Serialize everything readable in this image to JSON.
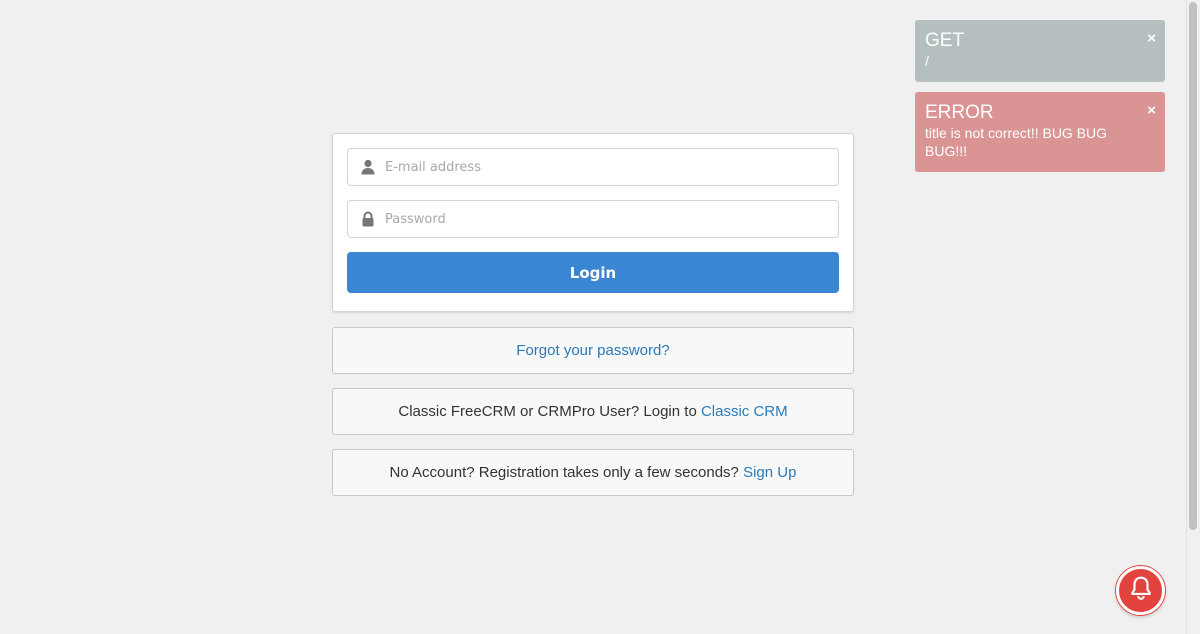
{
  "login_form": {
    "email_placeholder": "E-mail address",
    "password_placeholder": "Password",
    "login_label": "Login"
  },
  "links": {
    "forgot_password": "Forgot your password?",
    "classic_prefix": "Classic FreeCRM or CRMPro User? Login to ",
    "classic_link": "Classic CRM",
    "signup_prefix": "No Account? Registration takes only a few seconds? ",
    "signup_link": "Sign Up"
  },
  "toasts": [
    {
      "title": "GET",
      "message": "/",
      "close": "×",
      "color": "#b6bfbf"
    },
    {
      "title": "ERROR",
      "message": "title is not correct!! BUG BUG BUG!!!",
      "close": "×",
      "color": "#da9494"
    }
  ],
  "icons": {
    "email": "user-icon",
    "password": "lock-icon",
    "notification": "bell-icon"
  },
  "colors": {
    "primary": "#3b86d3",
    "link": "#2a7ab8",
    "bell": "#e3433f"
  }
}
